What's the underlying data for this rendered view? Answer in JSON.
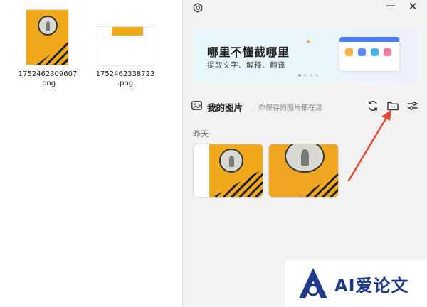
{
  "explorer": {
    "files": [
      {
        "name_line1": "1752462309607",
        "name_line2": ".png"
      },
      {
        "name_line1": "1752462338723",
        "name_line2": ".png"
      }
    ]
  },
  "panel": {
    "window_controls": {
      "minimize": "—",
      "close": "✕"
    },
    "banner": {
      "title": "哪里不懂截哪里",
      "subtitle": "提取文字、解释、翻译"
    },
    "section": {
      "title": "我的图片",
      "hint": "你保存的图片都在这"
    },
    "group_label": "昨天"
  },
  "watermark": {
    "text": "AI爱论文"
  },
  "colors": {
    "accent": "#e8472f",
    "image_yellow": "#f0a81c",
    "brand": "#1f3a8a"
  }
}
